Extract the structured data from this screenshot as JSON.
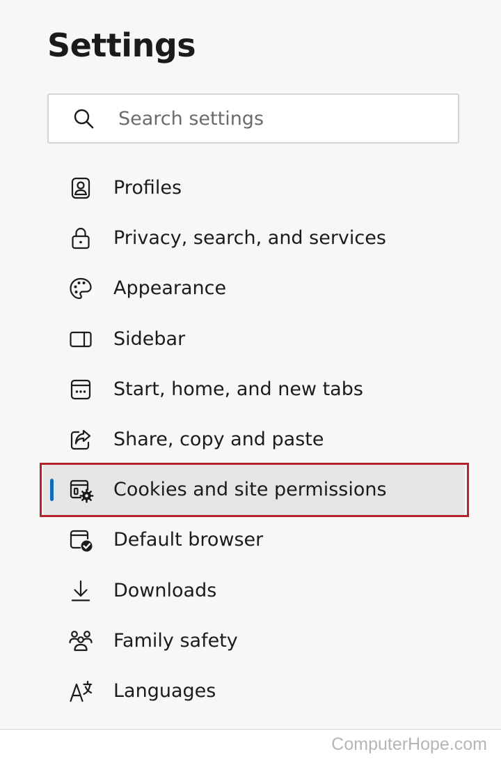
{
  "header": {
    "title": "Settings"
  },
  "search": {
    "placeholder": "Search settings",
    "value": "",
    "icon": "search-icon"
  },
  "sidebar": {
    "active_index": 6,
    "accent_color": "#0f6cbd",
    "highlight_border_color": "#b3242d",
    "items": [
      {
        "label": "Profiles",
        "icon": "profile-icon"
      },
      {
        "label": "Privacy, search, and services",
        "icon": "lock-icon"
      },
      {
        "label": "Appearance",
        "icon": "palette-icon"
      },
      {
        "label": "Sidebar",
        "icon": "sidebar-icon"
      },
      {
        "label": "Start, home, and new tabs",
        "icon": "start-home-icon"
      },
      {
        "label": "Share, copy and paste",
        "icon": "share-icon"
      },
      {
        "label": "Cookies and site permissions",
        "icon": "cookies-permissions-icon"
      },
      {
        "label": "Default browser",
        "icon": "default-browser-icon"
      },
      {
        "label": "Downloads",
        "icon": "download-icon"
      },
      {
        "label": "Family safety",
        "icon": "family-icon"
      },
      {
        "label": "Languages",
        "icon": "languages-icon"
      }
    ]
  },
  "watermark": {
    "text": "ComputerHope.com"
  }
}
